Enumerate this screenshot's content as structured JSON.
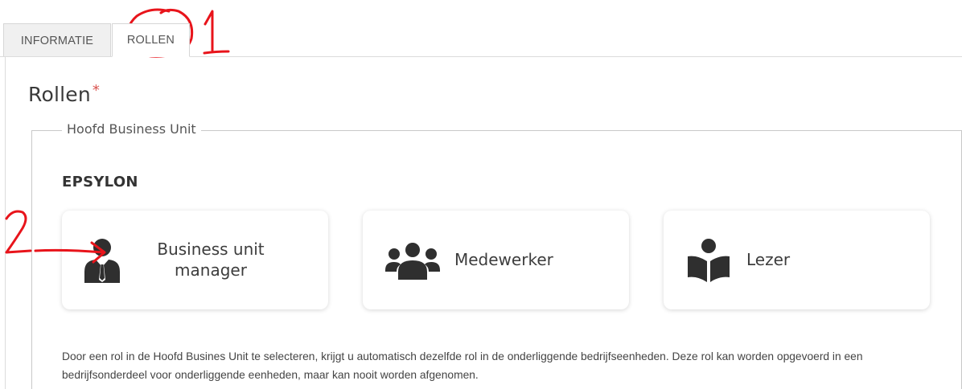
{
  "tabs": [
    {
      "label": "INFORMATIE",
      "active": false
    },
    {
      "label": "ROLLEN",
      "active": true
    }
  ],
  "section": {
    "title": "Rollen",
    "required_mark": "*"
  },
  "fieldset": {
    "legend": "Hoofd Business Unit",
    "business_unit": "EPSYLON"
  },
  "roles": [
    {
      "line1": "Business unit",
      "line2": "manager",
      "icon": "manager-icon"
    },
    {
      "label": "Medewerker",
      "icon": "team-icon"
    },
    {
      "label": "Lezer",
      "icon": "reader-icon"
    }
  ],
  "description": "Door een rol in de Hoofd Busines Unit te selecteren, krijgt u automatisch dezelfde rol in de onderliggende bedrijfseenheden. Deze rol kan worden opgevoerd in een bedrijfsonderdeel voor onderliggende eenheden, maar kan nooit worden afgenomen.",
  "annotations": {
    "mark_1": "1",
    "mark_2": "2"
  },
  "colors": {
    "required": "#d9534f",
    "annotation": "#e8141b",
    "icon": "#2f2f2f"
  }
}
